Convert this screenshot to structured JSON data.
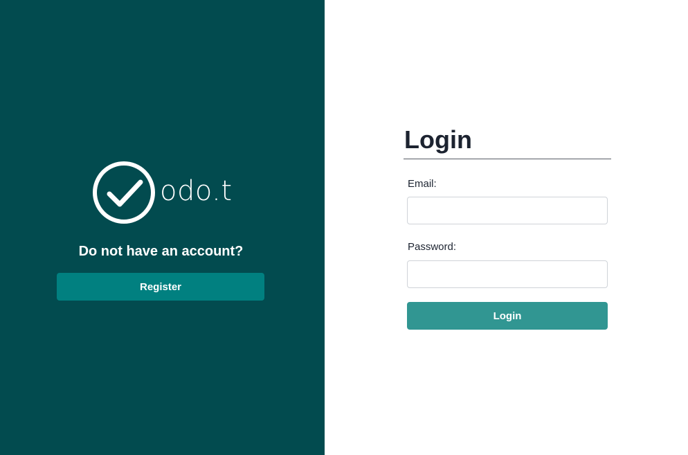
{
  "brand": {
    "wordmark": "odo.t",
    "logo_icon": "check-circle-icon",
    "panel_color": "#024b4f"
  },
  "register_section": {
    "prompt": "Do not have an account?",
    "register_label": "Register",
    "button_color": "#018080"
  },
  "login_form": {
    "title": "Login",
    "email_label": "Email:",
    "email_value": "",
    "password_label": "Password:",
    "password_value": "",
    "submit_label": "Login",
    "button_color": "#319692"
  }
}
